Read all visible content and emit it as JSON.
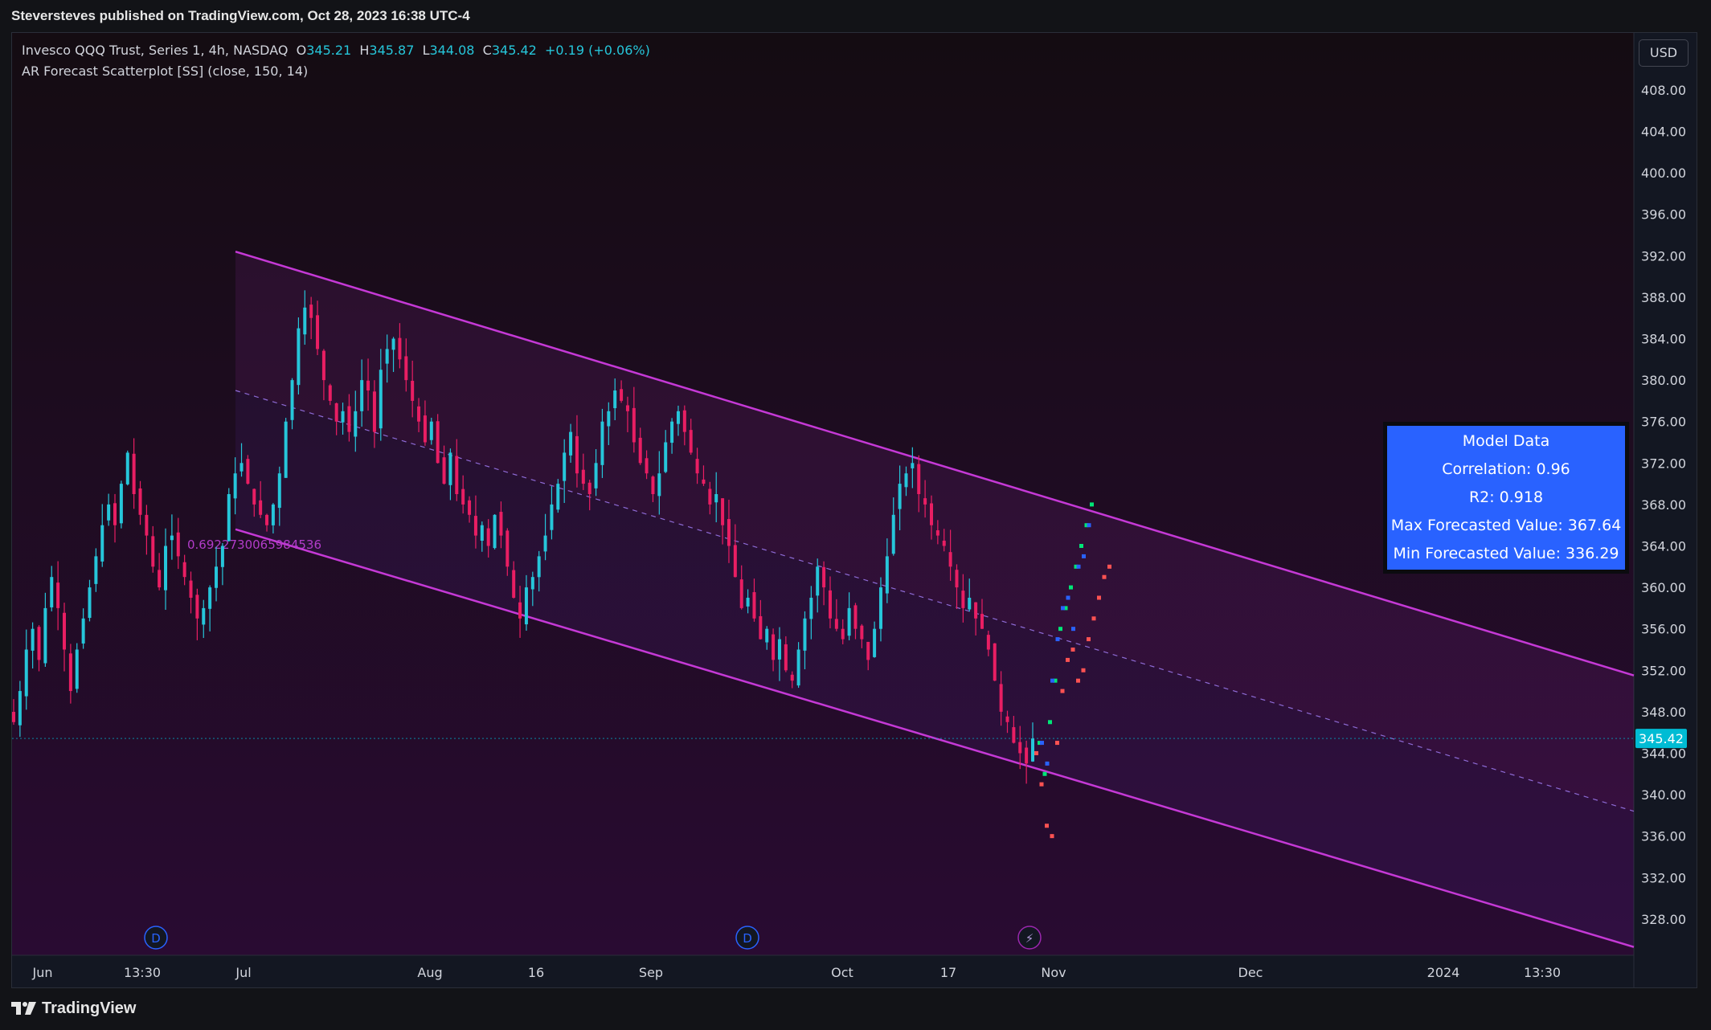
{
  "publish_info": "Steversteves published on TradingView.com, Oct 28, 2023 16:38 UTC-4",
  "legend": {
    "symbol": "Invesco QQQ Trust, Series 1, 4h, NASDAQ",
    "o_label": "O",
    "o_value": "345.21",
    "h_label": "H",
    "h_value": "345.87",
    "l_label": "L",
    "l_value": "344.08",
    "c_label": "C",
    "c_value": "345.42",
    "change": "+0.19 (+0.06%)",
    "indicator": "AR Forecast Scatterplot [SS] (close, 150, 14)"
  },
  "currency": "USD",
  "model_table": {
    "title": "Model Data",
    "correlation": "Correlation: 0.96",
    "r2": "R2: 0.918",
    "max": "Max Forecasted Value: 367.64",
    "min": "Min Forecasted Value: 336.29"
  },
  "brand": "TradingView",
  "colors": {
    "background_top": "#140c12",
    "background_bottom": "#2a0b33",
    "up_candle": "#26c6da",
    "down_candle": "#e91e63",
    "channel": "#c539d6",
    "forecast_green": "#00e676",
    "forecast_blue": "#2962ff",
    "forecast_red": "#ff5252",
    "last_price_tag": "#00bcd4"
  },
  "chart_data": {
    "type": "candlestick",
    "symbol": "QQQ",
    "interval": "4h",
    "ylim": [
      324.5,
      413.5
    ],
    "y_ticks": [
      328,
      332,
      336,
      340,
      344,
      348,
      352,
      356,
      360,
      364,
      368,
      372,
      376,
      380,
      384,
      388,
      392,
      396,
      400,
      404,
      408
    ],
    "x_tick_labels": [
      "Jun",
      "13:30",
      "Jul",
      "Aug",
      "16",
      "Sep",
      "Oct",
      "17",
      "Nov",
      "Dec",
      "2024",
      "13:30"
    ],
    "last_price": 345.42,
    "channel": {
      "pearson_label": "0.6922730065984536",
      "upper_start": 392.4,
      "upper_end": 351.5,
      "mid_start": 379.0,
      "mid_end": 338.4,
      "lower_start": 365.6,
      "lower_end": 325.3
    },
    "close_path": [
      347,
      350,
      354,
      356,
      353,
      358,
      361,
      358,
      354,
      350,
      354,
      357,
      360,
      363,
      366,
      368,
      366,
      370,
      373,
      369,
      367,
      365,
      362,
      360,
      364,
      365,
      363,
      361,
      359,
      357,
      358,
      360,
      362,
      364,
      369,
      371,
      372,
      370,
      368,
      367,
      366,
      368,
      371,
      376,
      380,
      385,
      387,
      386,
      383,
      380,
      378,
      376,
      377,
      375,
      377,
      380,
      379,
      375,
      381,
      383,
      384,
      382,
      380,
      378,
      376,
      374,
      376,
      372,
      370,
      373,
      369,
      368,
      367,
      365,
      366,
      364,
      367,
      365,
      362,
      359,
      357,
      360,
      361,
      363,
      365,
      368,
      370,
      373,
      375,
      371,
      370,
      369,
      372,
      376,
      377,
      379,
      378,
      377,
      374,
      372,
      371,
      369,
      371,
      374,
      376,
      377,
      375,
      373,
      371,
      370,
      368,
      369,
      366,
      364,
      361,
      358,
      359,
      357,
      355,
      356,
      353,
      355,
      352,
      351,
      354,
      357,
      359,
      362,
      360,
      357,
      356,
      355,
      358,
      356,
      355,
      353,
      356,
      360,
      363,
      367,
      370,
      371,
      372,
      369,
      368,
      366,
      365,
      364,
      362,
      360,
      358,
      359,
      357,
      356,
      354,
      351,
      348,
      347,
      345,
      344,
      343,
      345.42
    ],
    "forecast_green": [
      345,
      342,
      347,
      351,
      356,
      358,
      360,
      362,
      364,
      366,
      368
    ],
    "forecast_blue": [
      345,
      343,
      351,
      355,
      358,
      359,
      356,
      362,
      363,
      366
    ],
    "forecast_red": [
      344,
      341,
      337,
      336,
      345,
      350,
      353,
      354,
      351,
      352,
      355,
      357,
      359,
      361,
      362
    ],
    "table_title": "Model Data"
  }
}
